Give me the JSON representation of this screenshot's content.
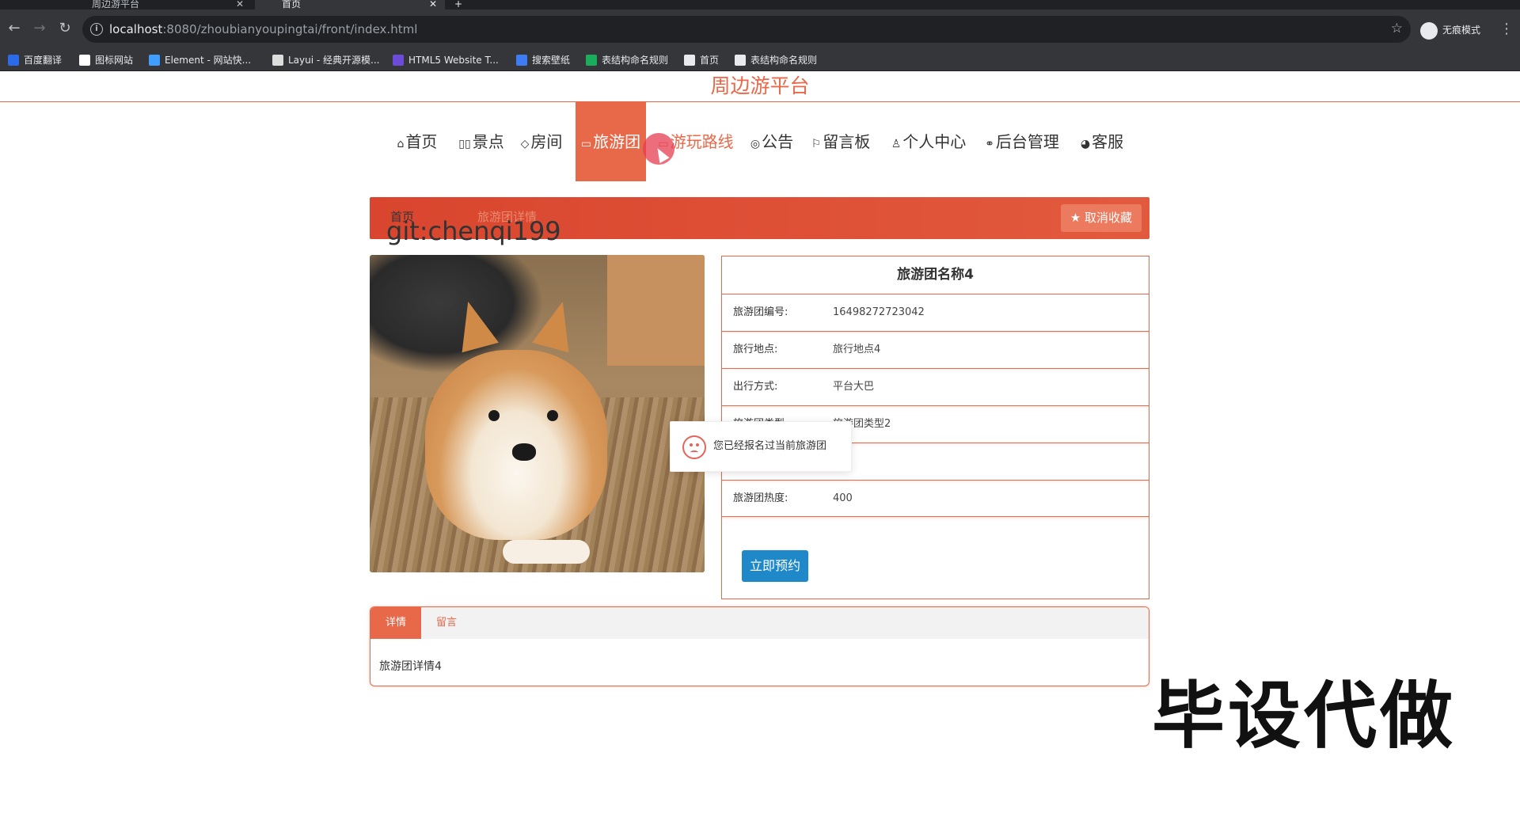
{
  "browser": {
    "tabs": [
      {
        "title": "周边游平台",
        "active": false
      },
      {
        "title": "首页",
        "active": true
      }
    ],
    "new_tab": "+",
    "url_host": "localhost",
    "url_rest": ":8080/zhoubianyoupingtai/front/index.html",
    "incognito_label": "无痕模式",
    "bookmarks": [
      {
        "label": "百度翻译",
        "color": "#2b6ae9"
      },
      {
        "label": "图标网站",
        "color": "#ffffff"
      },
      {
        "label": "Element - 网站快...",
        "color": "#409eff"
      },
      {
        "label": "Layui - 经典开源模...",
        "color": "#dddddd"
      },
      {
        "label": "HTML5 Website T...",
        "color": "#6c4bd8"
      },
      {
        "label": "搜索壁纸",
        "color": "#3d7cf2"
      },
      {
        "label": "表结构命名规则",
        "color": "#1aad5c"
      },
      {
        "label": "首页",
        "color": "#e8eaed"
      },
      {
        "label": "表结构命名规则",
        "color": "#e8eaed"
      }
    ]
  },
  "site": {
    "title": "周边游平台",
    "nav": [
      {
        "icon": "⌂",
        "label": "首页",
        "active": false
      },
      {
        "icon": "▯▯",
        "label": "景点",
        "active": false
      },
      {
        "icon": "◇",
        "label": "房间",
        "active": false
      },
      {
        "icon": "▭",
        "label": "旅游团",
        "active": true
      },
      {
        "icon": "▭",
        "label": "游玩路线",
        "active": false
      },
      {
        "icon": "◎",
        "label": "公告",
        "active": false
      },
      {
        "icon": "⚐",
        "label": "留言板",
        "active": false
      },
      {
        "icon": "♙",
        "label": "个人中心",
        "active": false
      },
      {
        "icon": "⚭",
        "label": "后台管理",
        "active": false
      },
      {
        "icon": "◕",
        "label": "客服",
        "active": false
      }
    ]
  },
  "breadcrumb": {
    "home": "首页",
    "current": "旅游团详情"
  },
  "favorite_button": "★ 取消收藏",
  "watermark": "git:chenqi199",
  "detail": {
    "name": "旅游团名称4",
    "fields": [
      {
        "key": "旅游团编号:",
        "value": "16498272723042"
      },
      {
        "key": "旅行地点:",
        "value": "旅行地点4"
      },
      {
        "key": "出行方式:",
        "value": "平台大巴"
      },
      {
        "key": "旅游团类型:",
        "value": "旅游团类型2"
      },
      {
        "key": "",
        "value": ""
      },
      {
        "key": "旅游团热度:",
        "value": "400"
      }
    ],
    "book_button": "立即预约"
  },
  "toast": {
    "message": "您已经报名过当前旅游团"
  },
  "panel": {
    "tabs": [
      {
        "label": "详情",
        "active": true
      },
      {
        "label": "留言",
        "active": false
      }
    ],
    "content": "旅游团详情4"
  },
  "overlay_text": "毕设代做"
}
